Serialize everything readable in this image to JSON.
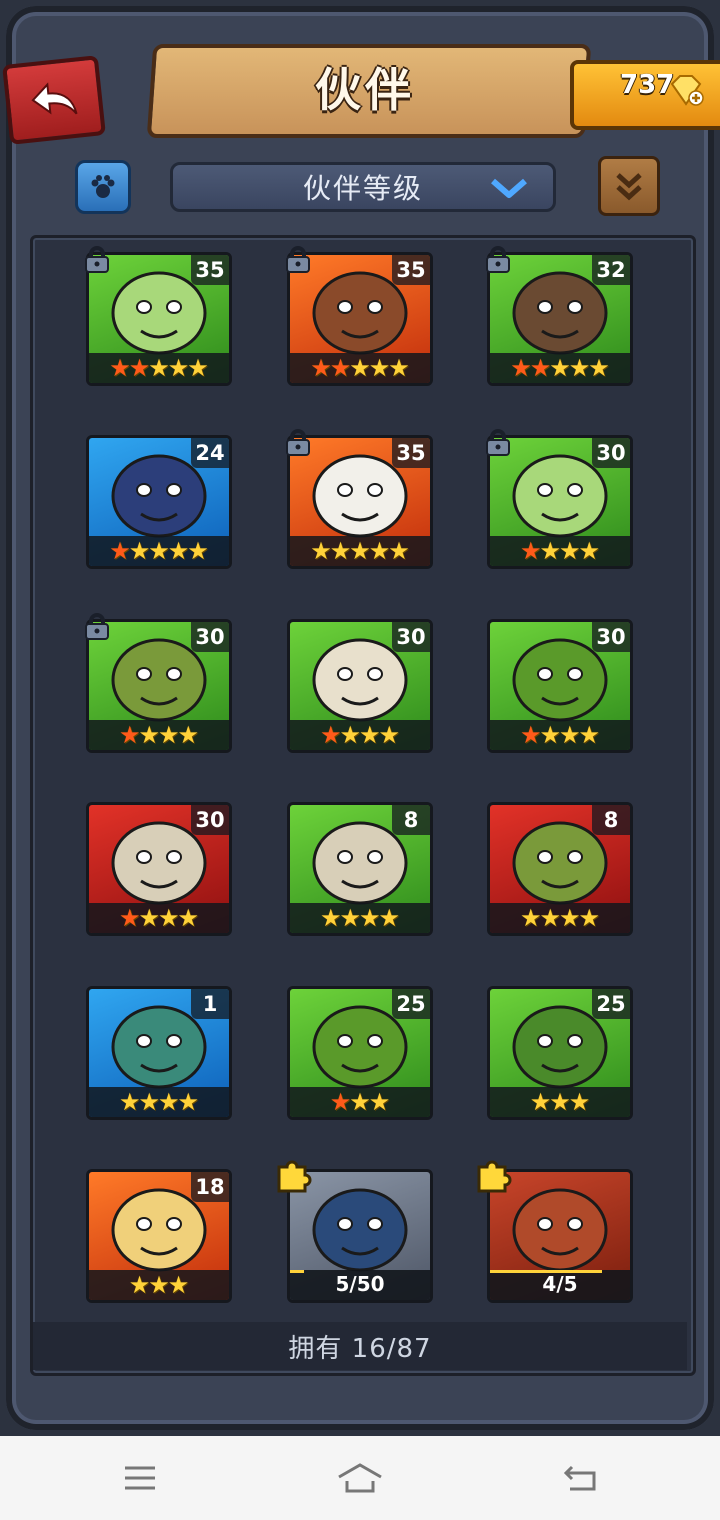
{
  "header": {
    "title": "伙伴",
    "gems": "737"
  },
  "filter": {
    "dropdown_label": "伙伴等级"
  },
  "colors": {
    "gold": "#ffd23a",
    "red_star": "#ff5a1a",
    "frame": "#3b4355"
  },
  "companions": [
    {
      "level": "35",
      "stars": 5,
      "red_stars": 2,
      "bg": "green",
      "locked": true,
      "portrait": "lizard-icon"
    },
    {
      "level": "35",
      "stars": 5,
      "red_stars": 2,
      "bg": "orange",
      "locked": true,
      "portrait": "woman-warrior-icon"
    },
    {
      "level": "32",
      "stars": 5,
      "red_stars": 2,
      "bg": "green",
      "locked": true,
      "portrait": "barbarian-icon"
    },
    {
      "level": "24",
      "stars": 5,
      "red_stars": 1,
      "bg": "blue",
      "locked": false,
      "portrait": "hooded-mage-icon"
    },
    {
      "level": "35",
      "stars": 5,
      "red_stars": 0,
      "bg": "orange",
      "locked": true,
      "portrait": "panda-icon"
    },
    {
      "level": "30",
      "stars": 4,
      "red_stars": 1,
      "bg": "green",
      "locked": true,
      "portrait": "lizard-icon"
    },
    {
      "level": "30",
      "stars": 4,
      "red_stars": 1,
      "bg": "green",
      "locked": true,
      "portrait": "scarecrow-icon"
    },
    {
      "level": "30",
      "stars": 4,
      "red_stars": 1,
      "bg": "green",
      "locked": false,
      "portrait": "rhino-icon"
    },
    {
      "level": "30",
      "stars": 4,
      "red_stars": 1,
      "bg": "green",
      "locked": false,
      "portrait": "orc-boar-icon"
    },
    {
      "level": "30",
      "stars": 4,
      "red_stars": 1,
      "bg": "red",
      "locked": false,
      "portrait": "skull-totem-icon"
    },
    {
      "level": "8",
      "stars": 4,
      "red_stars": 0,
      "bg": "green",
      "locked": false,
      "portrait": "skull-totem-icon"
    },
    {
      "level": "8",
      "stars": 4,
      "red_stars": 0,
      "bg": "red",
      "locked": false,
      "portrait": "scarecrow-icon"
    },
    {
      "level": "1",
      "stars": 4,
      "red_stars": 0,
      "bg": "blue",
      "locked": false,
      "portrait": "troll-icon"
    },
    {
      "level": "25",
      "stars": 3,
      "red_stars": 1,
      "bg": "green",
      "locked": false,
      "portrait": "orc-boar-icon"
    },
    {
      "level": "25",
      "stars": 3,
      "red_stars": 0,
      "bg": "green",
      "locked": false,
      "portrait": "crocodile-icon"
    },
    {
      "level": "18",
      "stars": 3,
      "red_stars": 0,
      "bg": "orange",
      "locked": false,
      "portrait": "blonde-warrior-icon"
    },
    {
      "progress": "5/50",
      "progress_value": 0.1,
      "bg": "gray",
      "puzzle": true,
      "portrait": "fish-icon"
    },
    {
      "progress": "4/5",
      "progress_value": 0.8,
      "bg": "rust",
      "puzzle": true,
      "portrait": "dragon-icon"
    }
  ],
  "footer": {
    "owned_text": "拥有 16/87"
  },
  "navbar": {
    "menu": "menu-icon",
    "home": "home-icon",
    "back": "back-icon"
  }
}
